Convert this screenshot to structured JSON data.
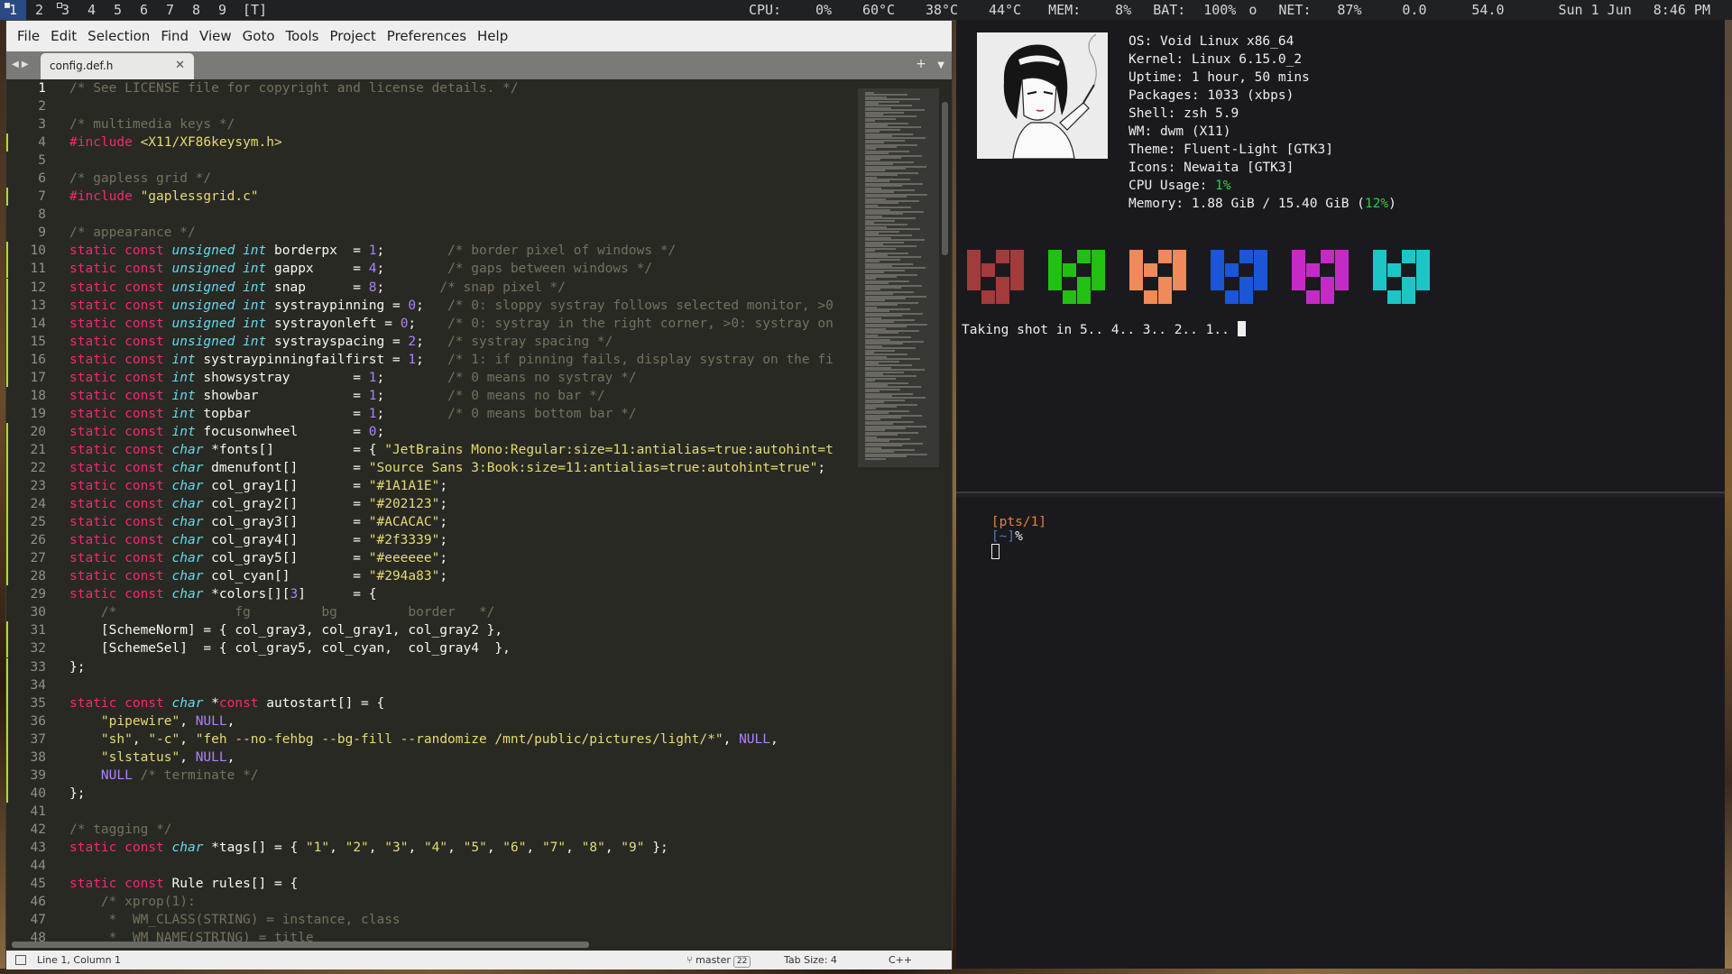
{
  "topbar": {
    "tags": [
      "1",
      "2",
      "3",
      "4",
      "5",
      "6",
      "7",
      "8",
      "9"
    ],
    "selected_tag": "1",
    "layout": "[T]",
    "cpu_label": "CPU:",
    "cpu": "0%",
    "temp1": "60°C",
    "temp2": "38°C",
    "temp3": "44°C",
    "mem_label": "MEM:",
    "mem": "8%",
    "bat_label": "BAT:",
    "bat": "100%",
    "bat_state": "o",
    "net_label": "NET:",
    "net": "87%",
    "val1": "0.0",
    "val2": "54.0",
    "date": "Sun  1 Jun",
    "time": "8:46 PM"
  },
  "editor": {
    "menu": [
      "File",
      "Edit",
      "Selection",
      "Find",
      "View",
      "Goto",
      "Tools",
      "Project",
      "Preferences",
      "Help"
    ],
    "tab_title": "config.def.h",
    "status": {
      "position": "Line 1, Column 1",
      "branch": "master",
      "branch_badge": "22",
      "tab_size": "Tab Size: 4",
      "syntax": "C++"
    }
  },
  "fetch": {
    "os_label": "OS:",
    "os": "Void Linux x86_64",
    "kernel_label": "Kernel:",
    "kernel": "Linux 6.15.0_2",
    "uptime_label": "Uptime:",
    "uptime": "1 hour, 50 mins",
    "packages_label": "Packages:",
    "packages": "1033 (xbps)",
    "shell_label": "Shell:",
    "shell": "zsh 5.9",
    "wm_label": "WM:",
    "wm": "dwm (X11)",
    "theme_label": "Theme:",
    "theme": "Fluent-Light [GTK3]",
    "icons_label": "Icons:",
    "icons": "Newaita [GTK3]",
    "cpu_label": "CPU Usage:",
    "cpu": "1%",
    "mem_label": "Memory:",
    "mem_pre": "1.88 GiB / 15.40 GiB (",
    "mem_pct": "12%",
    "mem_post": ")",
    "block_colors": [
      "#a23b3b",
      "#22c012",
      "#f08a5a",
      "#1a56d6",
      "#c62ac6",
      "#1cc6c6"
    ],
    "countdown": "Taking shot in 5.. 4.. 3.. 2.. 1.. "
  },
  "term2": {
    "prompt_tty": "[pts/1]",
    "prompt_dir": "[~]",
    "prompt_sym": "%"
  },
  "code_lines": [
    [
      [
        "c",
        "/* See LICENSE file for copyright and license details. */"
      ]
    ],
    [],
    [
      [
        "c",
        "/* multimedia keys */"
      ]
    ],
    [
      [
        "k",
        "#include "
      ],
      [
        "s",
        "<X11/XF86keysym.h>"
      ]
    ],
    [],
    [
      [
        "c",
        "/* gapless grid */"
      ]
    ],
    [
      [
        "k",
        "#include "
      ],
      [
        "s",
        "\"gaplessgrid.c\""
      ]
    ],
    [],
    [
      [
        "c",
        "/* appearance */"
      ]
    ],
    [
      [
        "k",
        "static const "
      ],
      [
        "t",
        "unsigned int "
      ],
      [
        "p",
        "borderpx  = "
      ],
      [
        "n",
        "1"
      ],
      [
        "p",
        ";        "
      ],
      [
        "c",
        "/* border pixel of windows */"
      ]
    ],
    [
      [
        "k",
        "static const "
      ],
      [
        "t",
        "unsigned int "
      ],
      [
        "p",
        "gappx     = "
      ],
      [
        "n",
        "4"
      ],
      [
        "p",
        ";        "
      ],
      [
        "c",
        "/* gaps between windows */"
      ]
    ],
    [
      [
        "k",
        "static const "
      ],
      [
        "t",
        "unsigned int "
      ],
      [
        "p",
        "snap      = "
      ],
      [
        "n",
        "8"
      ],
      [
        "p",
        ";       "
      ],
      [
        "c",
        "/* snap pixel */"
      ]
    ],
    [
      [
        "k",
        "static const "
      ],
      [
        "t",
        "unsigned int "
      ],
      [
        "p",
        "systraypinning = "
      ],
      [
        "n",
        "0"
      ],
      [
        "p",
        ";   "
      ],
      [
        "c",
        "/* 0: sloppy systray follows selected monitor, >0"
      ]
    ],
    [
      [
        "k",
        "static const "
      ],
      [
        "t",
        "unsigned int "
      ],
      [
        "p",
        "systrayonleft = "
      ],
      [
        "n",
        "0"
      ],
      [
        "p",
        ";    "
      ],
      [
        "c",
        "/* 0: systray in the right corner, >0: systray on"
      ]
    ],
    [
      [
        "k",
        "static const "
      ],
      [
        "t",
        "unsigned int "
      ],
      [
        "p",
        "systrayspacing = "
      ],
      [
        "n",
        "2"
      ],
      [
        "p",
        ";   "
      ],
      [
        "c",
        "/* systray spacing */"
      ]
    ],
    [
      [
        "k",
        "static const "
      ],
      [
        "t",
        "int "
      ],
      [
        "p",
        "systraypinningfailfirst = "
      ],
      [
        "n",
        "1"
      ],
      [
        "p",
        ";   "
      ],
      [
        "c",
        "/* 1: if pinning fails, display systray on the fi"
      ]
    ],
    [
      [
        "k",
        "static const "
      ],
      [
        "t",
        "int "
      ],
      [
        "p",
        "showsystray        = "
      ],
      [
        "n",
        "1"
      ],
      [
        "p",
        ";        "
      ],
      [
        "c",
        "/* 0 means no systray */"
      ]
    ],
    [
      [
        "k",
        "static const "
      ],
      [
        "t",
        "int "
      ],
      [
        "p",
        "showbar            = "
      ],
      [
        "n",
        "1"
      ],
      [
        "p",
        ";        "
      ],
      [
        "c",
        "/* 0 means no bar */"
      ]
    ],
    [
      [
        "k",
        "static const "
      ],
      [
        "t",
        "int "
      ],
      [
        "p",
        "topbar             = "
      ],
      [
        "n",
        "1"
      ],
      [
        "p",
        ";        "
      ],
      [
        "c",
        "/* 0 means bottom bar */"
      ]
    ],
    [
      [
        "k",
        "static const "
      ],
      [
        "t",
        "int "
      ],
      [
        "p",
        "focusonwheel       = "
      ],
      [
        "n",
        "0"
      ],
      [
        "p",
        ";"
      ]
    ],
    [
      [
        "k",
        "static const "
      ],
      [
        "t",
        "char "
      ],
      [
        "p",
        "*fonts[]          = { "
      ],
      [
        "s",
        "\"JetBrains Mono:Regular:size=11:antialias=true:autohint=t"
      ]
    ],
    [
      [
        "k",
        "static const "
      ],
      [
        "t",
        "char "
      ],
      [
        "p",
        "dmenufont[]       = "
      ],
      [
        "s",
        "\"Source Sans 3:Book:size=11:antialias=true:autohint=true\""
      ],
      [
        "p",
        ";"
      ]
    ],
    [
      [
        "k",
        "static const "
      ],
      [
        "t",
        "char "
      ],
      [
        "p",
        "col_gray1[]       = "
      ],
      [
        "s",
        "\"#1A1A1E\""
      ],
      [
        "p",
        ";"
      ]
    ],
    [
      [
        "k",
        "static const "
      ],
      [
        "t",
        "char "
      ],
      [
        "p",
        "col_gray2[]       = "
      ],
      [
        "s",
        "\"#202123\""
      ],
      [
        "p",
        ";"
      ]
    ],
    [
      [
        "k",
        "static const "
      ],
      [
        "t",
        "char "
      ],
      [
        "p",
        "col_gray3[]       = "
      ],
      [
        "s",
        "\"#ACACAC\""
      ],
      [
        "p",
        ";"
      ]
    ],
    [
      [
        "k",
        "static const "
      ],
      [
        "t",
        "char "
      ],
      [
        "p",
        "col_gray4[]       = "
      ],
      [
        "s",
        "\"#2f3339\""
      ],
      [
        "p",
        ";"
      ]
    ],
    [
      [
        "k",
        "static const "
      ],
      [
        "t",
        "char "
      ],
      [
        "p",
        "col_gray5[]       = "
      ],
      [
        "s",
        "\"#eeeeee\""
      ],
      [
        "p",
        ";"
      ]
    ],
    [
      [
        "k",
        "static const "
      ],
      [
        "t",
        "char "
      ],
      [
        "p",
        "col_cyan[]        = "
      ],
      [
        "s",
        "\"#294a83\""
      ],
      [
        "p",
        ";"
      ]
    ],
    [
      [
        "k",
        "static const "
      ],
      [
        "t",
        "char "
      ],
      [
        "p",
        "*colors[]["
      ],
      [
        "n",
        "3"
      ],
      [
        "p",
        "]      = {"
      ]
    ],
    [
      [
        "c",
        "    /*               fg         bg         border   */"
      ]
    ],
    [
      [
        "p",
        "    [SchemeNorm] = { col_gray3, col_gray1, col_gray2 },"
      ]
    ],
    [
      [
        "p",
        "    [SchemeSel]  = { col_gray5, col_cyan,  col_gray4  },"
      ]
    ],
    [
      [
        "p",
        "};"
      ]
    ],
    [],
    [
      [
        "k",
        "static const "
      ],
      [
        "t",
        "char "
      ],
      [
        "p",
        "*"
      ],
      [
        "k",
        "const "
      ],
      [
        "p",
        "autostart[] = {"
      ]
    ],
    [
      [
        "p",
        "    "
      ],
      [
        "s",
        "\"pipewire\""
      ],
      [
        "p",
        ", "
      ],
      [
        "n",
        "NULL"
      ],
      [
        "p",
        ","
      ]
    ],
    [
      [
        "p",
        "    "
      ],
      [
        "s",
        "\"sh\""
      ],
      [
        "p",
        ", "
      ],
      [
        "s",
        "\"-c\""
      ],
      [
        "p",
        ", "
      ],
      [
        "s",
        "\"feh --no-fehbg --bg-fill --randomize /mnt/public/pictures/light/*\""
      ],
      [
        "p",
        ", "
      ],
      [
        "n",
        "NULL"
      ],
      [
        "p",
        ","
      ]
    ],
    [
      [
        "p",
        "    "
      ],
      [
        "s",
        "\"slstatus\""
      ],
      [
        "p",
        ", "
      ],
      [
        "n",
        "NULL"
      ],
      [
        "p",
        ","
      ]
    ],
    [
      [
        "p",
        "    "
      ],
      [
        "n",
        "NULL "
      ],
      [
        "c",
        "/* terminate */"
      ]
    ],
    [
      [
        "p",
        "};"
      ]
    ],
    [],
    [
      [
        "c",
        "/* tagging */"
      ]
    ],
    [
      [
        "k",
        "static const "
      ],
      [
        "t",
        "char "
      ],
      [
        "p",
        "*tags[] = { "
      ],
      [
        "s",
        "\"1\""
      ],
      [
        "p",
        ", "
      ],
      [
        "s",
        "\"2\""
      ],
      [
        "p",
        ", "
      ],
      [
        "s",
        "\"3\""
      ],
      [
        "p",
        ", "
      ],
      [
        "s",
        "\"4\""
      ],
      [
        "p",
        ", "
      ],
      [
        "s",
        "\"5\""
      ],
      [
        "p",
        ", "
      ],
      [
        "s",
        "\"6\""
      ],
      [
        "p",
        ", "
      ],
      [
        "s",
        "\"7\""
      ],
      [
        "p",
        ", "
      ],
      [
        "s",
        "\"8\""
      ],
      [
        "p",
        ", "
      ],
      [
        "s",
        "\"9\""
      ],
      [
        "p",
        " };"
      ]
    ],
    [],
    [
      [
        "k",
        "static const "
      ],
      [
        "p",
        "Rule rules[] = {"
      ]
    ],
    [
      [
        "c",
        "    /* xprop(1):"
      ]
    ],
    [
      [
        "c",
        "     *  WM_CLASS(STRING) = instance, class"
      ]
    ],
    [
      [
        "c",
        "     *  WM_NAME(STRING) = title"
      ]
    ]
  ],
  "modified_lines": [
    4,
    7,
    10,
    11,
    12,
    13,
    14,
    15,
    16,
    17,
    20,
    21,
    22,
    23,
    24,
    25,
    26,
    27,
    28,
    31,
    32,
    33,
    34,
    35,
    36,
    37,
    38,
    39,
    40
  ]
}
